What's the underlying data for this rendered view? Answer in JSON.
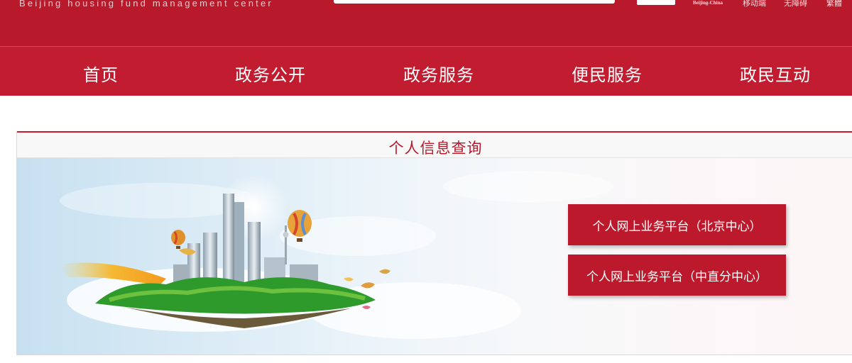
{
  "header": {
    "brand_en": "Beijing housing fund management center",
    "beijing_logo_text": "Beijing-China",
    "utility_links": [
      "移动端",
      "无障碍",
      "繁體"
    ]
  },
  "nav": {
    "items": [
      "首页",
      "政务公开",
      "政务服务",
      "便民服务",
      "政民互动"
    ]
  },
  "panel": {
    "title": "个人信息查询",
    "buttons": [
      "个人网上业务平台（北京中心）",
      "个人网上业务平台（中直分中心）"
    ]
  },
  "colors": {
    "brand_red": "#b8192b",
    "nav_red": "#c11c2f",
    "button_red": "#bc1a2c"
  }
}
